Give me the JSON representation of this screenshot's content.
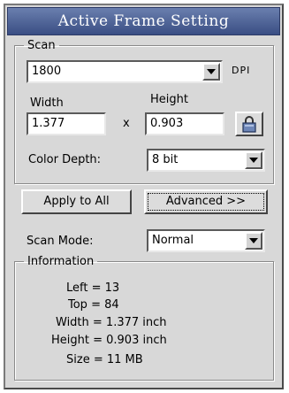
{
  "window": {
    "title": "Active Frame Setting"
  },
  "scan": {
    "legend": "Scan",
    "resolution": "1800",
    "resolution_unit": "DPI",
    "width_label": "Width",
    "height_label": "Height",
    "width_value": "1.377",
    "times_symbol": "x",
    "height_value": "0.903",
    "color_depth_label": "Color Depth:",
    "color_depth_value": "8 bit"
  },
  "buttons": {
    "apply_all": "Apply to All",
    "advanced": "Advanced >>"
  },
  "scan_mode": {
    "label": "Scan Mode:",
    "value": "Normal"
  },
  "information": {
    "legend": "Information",
    "rows": [
      "Left = 13",
      "Top = 84",
      "Width = 1.377 inch",
      "Height = 0.903 inch",
      "Size = 11 MB"
    ]
  },
  "icons": {
    "lock": "padlock-icon",
    "dropdown": "chevron-down-icon"
  }
}
